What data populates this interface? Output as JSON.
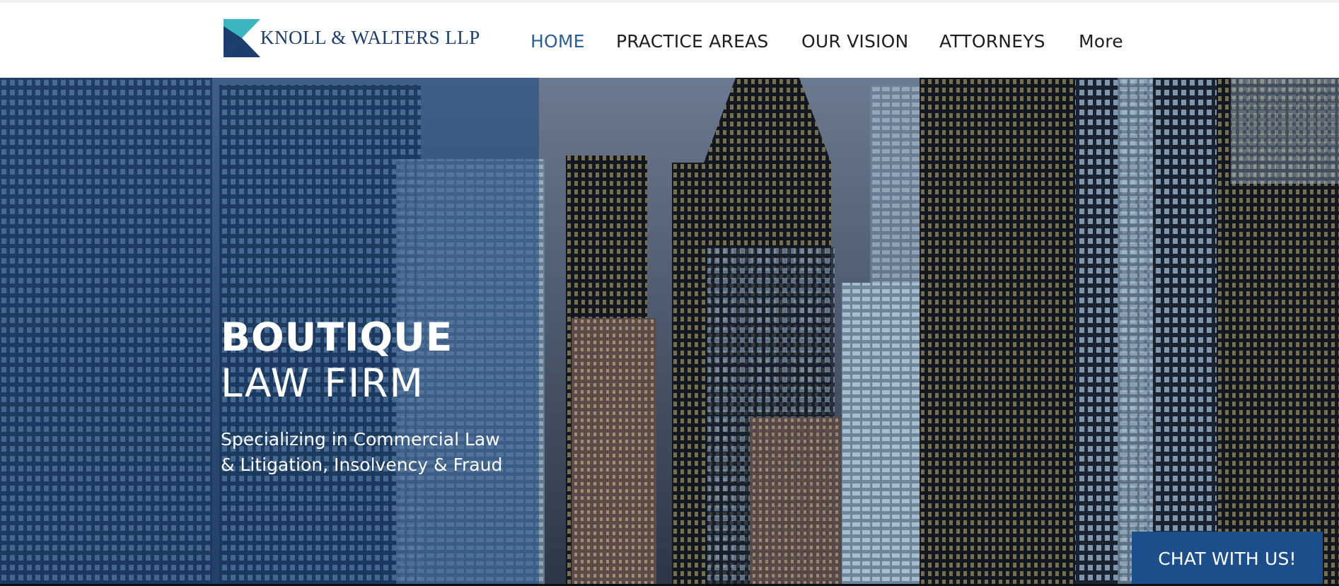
{
  "brand": {
    "name": "KNOLL & WALTERS LLP",
    "colors": {
      "primary": "#1b3e6e",
      "teal": "#3bb6bf",
      "accent_nav": "#2b5f9a",
      "chat": "#1d4e8c"
    }
  },
  "nav": {
    "items": [
      {
        "label": "HOME",
        "active": true
      },
      {
        "label": "PRACTICE AREAS",
        "active": false
      },
      {
        "label": "OUR VISION",
        "active": false
      },
      {
        "label": "ATTORNEYS",
        "active": false
      },
      {
        "label": "More",
        "active": false
      }
    ]
  },
  "hero": {
    "title_line1": "BOUTIQUE",
    "title_line2": "LAW FIRM",
    "subtitle_line1": "Specializing in Commercial Law",
    "subtitle_line2": "& Litigation, Insolvency & Fraud"
  },
  "chat": {
    "label": "CHAT WITH US!"
  }
}
